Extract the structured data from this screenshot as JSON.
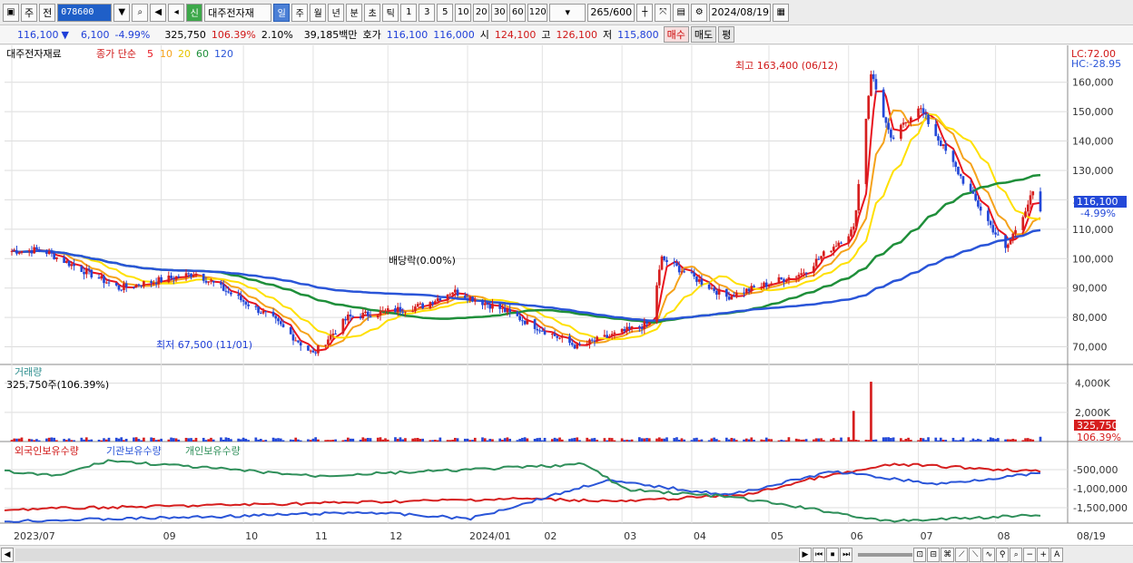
{
  "toolbar": {
    "market": "주",
    "market_kind": "전",
    "code": "078600",
    "new_badge": "신",
    "stock_name": "대주전자재",
    "periods": [
      "일",
      "주",
      "월",
      "년",
      "분",
      "초",
      "틱"
    ],
    "minutes": [
      "1",
      "3",
      "5",
      "10",
      "20",
      "30",
      "60",
      "120"
    ],
    "count": "265",
    "count_total": "/600",
    "date": "2024/08/19"
  },
  "quote": {
    "price": "116,100",
    "arrow": "▼",
    "change": "6,100",
    "change_pct": "-4.99%",
    "volume": "325,750",
    "vol_ratio": "106.39%",
    "turnover": "2.10%",
    "amount": "39,185백만",
    "hoga_label": "호가",
    "hoga1": "116,100",
    "hoga2": "116,000",
    "open_label": "시",
    "open": "124,100",
    "high_label": "고",
    "high": "126,100",
    "low_label": "저",
    "low": "115,800",
    "buy": "매수",
    "sell": "매도",
    "avg": "평"
  },
  "colors": {
    "up": "#d61e1e",
    "down": "#2348d8",
    "ma5": "#e8141e",
    "ma10": "#f5a21b",
    "ma20": "#ffe000",
    "ma60": "#1f8f3a",
    "ma120": "#2a55d8",
    "foreign": "#d61e1e",
    "inst": "#2a55d8",
    "indiv": "#2f8f5a"
  },
  "legend": {
    "tag": "대주전자재료",
    "series": "종가 단순",
    "ma": [
      {
        "label": "5",
        "color": "#e8141e"
      },
      {
        "label": "10",
        "color": "#f5a21b"
      },
      {
        "label": "20",
        "color": "#ffe000"
      },
      {
        "label": "60",
        "color": "#1f8f3a"
      },
      {
        "label": "120",
        "color": "#2a55d8"
      }
    ]
  },
  "annotations": {
    "high": "최고 163,400 (06/12)",
    "low": "최저 67,500 (11/01)",
    "dividend": "배당락(0.00%)",
    "lc": "LC:72.00",
    "hc": "HC:-28.95",
    "price_tag": "116,100",
    "pct_tag": "-4.99%",
    "vol_title": "거래량",
    "vol_info": "325,750주(106.39%)",
    "vol_tag": "325,750",
    "vol_pct_tag": "106.39%"
  },
  "holding_panel": {
    "labels": [
      "외국인보유수량",
      "기관보유수량",
      "개인보유수량"
    ]
  },
  "chart_data": [
    {
      "type": "candlestick",
      "title": "대주전자재료 일봉",
      "y_ticks": [
        "160,000",
        "150,000",
        "140,000",
        "130,000",
        "120,000",
        "110,000",
        "100,000",
        "90,000",
        "80,000",
        "70,000"
      ],
      "ylim": [
        64000,
        167000
      ],
      "x_labels": [
        "2023/07",
        "09",
        "10",
        "11",
        "12",
        "2024/01",
        "02",
        "03",
        "04",
        "05",
        "06",
        "07",
        "08",
        "08/19"
      ],
      "key_points": [
        {
          "x": "2023-07",
          "close": 103000
        },
        {
          "x": "2023-08",
          "close": 90000
        },
        {
          "x": "2023-09",
          "close": 95000
        },
        {
          "x": "2023-10",
          "close": 80000
        },
        {
          "x": "2023-11-01",
          "close": 67500
        },
        {
          "x": "2023-11",
          "close": 80000
        },
        {
          "x": "2023-12",
          "close": 84000
        },
        {
          "x": "2023-12-27",
          "close": 89000
        },
        {
          "x": "2024-01",
          "close": 83000
        },
        {
          "x": "2024-02",
          "close": 70000
        },
        {
          "x": "2024-03",
          "close": 78000
        },
        {
          "x": "2024-03-20",
          "close": 100000
        },
        {
          "x": "2024-04",
          "close": 87000
        },
        {
          "x": "2024-05",
          "close": 95000
        },
        {
          "x": "2024-06-05",
          "close": 110000
        },
        {
          "x": "2024-06-12",
          "close": 163400
        },
        {
          "x": "2024-06-20",
          "close": 140000
        },
        {
          "x": "2024-07-01",
          "close": 152000
        },
        {
          "x": "2024-07-20",
          "close": 125000
        },
        {
          "x": "2024-08-05",
          "close": 103000
        },
        {
          "x": "2024-08-16",
          "close": 122200
        },
        {
          "x": "2024-08-19",
          "close": 116100
        }
      ],
      "ma_last": {
        "ma5": 116100,
        "ma10": 114000,
        "ma20": 113000,
        "ma60": 124000,
        "ma120": 108000
      }
    },
    {
      "type": "bar",
      "title": "거래량",
      "y_ticks": [
        "4,000K",
        "2,000K"
      ],
      "ylim": [
        0,
        4600
      ],
      "spikes": [
        {
          "x": "2024-06-05",
          "value": 2100
        },
        {
          "x": "2024-06-12",
          "value": 4100
        }
      ],
      "last": 325.75
    },
    {
      "type": "line",
      "title": "보유수량",
      "y_ticks": [
        "-500,000",
        "-1,000,000",
        "-1,500,000"
      ],
      "series": [
        {
          "name": "외국인보유수량"
        },
        {
          "name": "기관보유수량"
        },
        {
          "name": "개인보유수량"
        }
      ]
    }
  ],
  "bottom": {
    "nav": [
      "◀",
      "▶",
      "⏮",
      "⏹",
      "⏭"
    ]
  }
}
